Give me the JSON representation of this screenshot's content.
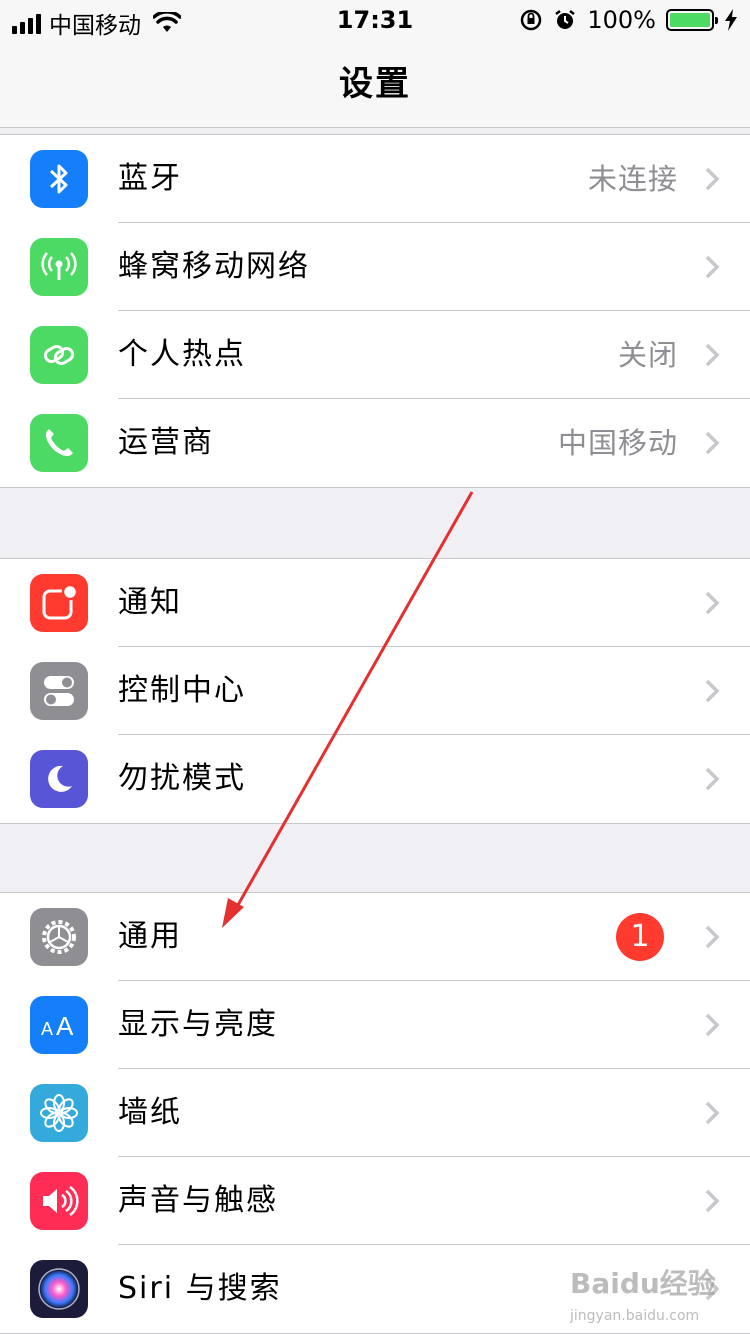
{
  "status_bar": {
    "carrier": "中国移动",
    "time": "17:31",
    "battery": "100%",
    "battery_level": 1.0
  },
  "nav": {
    "title": "设置"
  },
  "groups": [
    {
      "rows": [
        {
          "label": "蓝牙",
          "value": "未连接",
          "icon": "bluetooth-icon",
          "color": "#147efb"
        },
        {
          "label": "蜂窝移动网络",
          "value": "",
          "icon": "cellular-icon",
          "color": "#4cd964"
        },
        {
          "label": "个人热点",
          "value": "关闭",
          "icon": "hotspot-icon",
          "color": "#4cd964"
        },
        {
          "label": "运营商",
          "value": "中国移动",
          "icon": "phone-icon",
          "color": "#4cd964"
        }
      ]
    },
    {
      "rows": [
        {
          "label": "通知",
          "value": "",
          "icon": "notifications-icon",
          "color": "#ff3b30"
        },
        {
          "label": "控制中心",
          "value": "",
          "icon": "control-center-icon",
          "color": "#8e8e93"
        },
        {
          "label": "勿扰模式",
          "value": "",
          "icon": "moon-icon",
          "color": "#5856d6"
        }
      ]
    },
    {
      "rows": [
        {
          "label": "通用",
          "value": "",
          "badge": "1",
          "icon": "gear-icon",
          "color": "#8e8e93"
        },
        {
          "label": "显示与亮度",
          "value": "",
          "icon": "display-aa-icon",
          "color": "#147efb"
        },
        {
          "label": "墙纸",
          "value": "",
          "icon": "flower-icon",
          "color": "#34aadc"
        },
        {
          "label": "声音与触感",
          "value": "",
          "icon": "speaker-icon",
          "color": "#ff2d55"
        },
        {
          "label": "Siri 与搜索",
          "value": "",
          "icon": "siri-icon",
          "color": "#1c1c3a"
        }
      ]
    }
  ],
  "watermark": {
    "brand": "Baidu经验",
    "url": "jingyan.baidu.com"
  }
}
